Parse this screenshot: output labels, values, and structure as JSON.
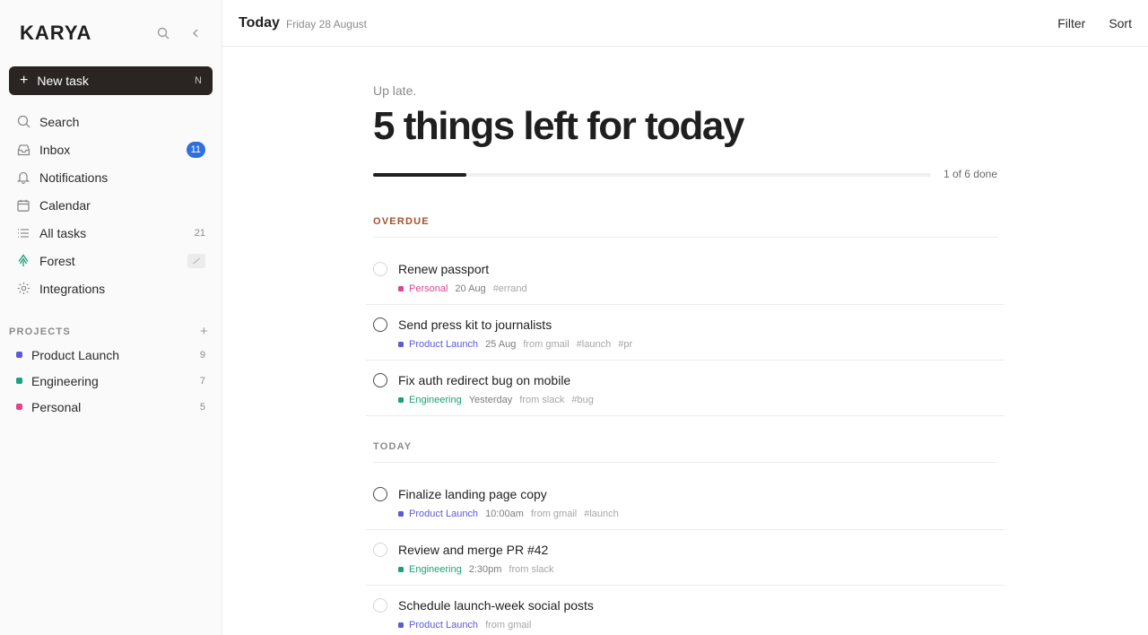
{
  "colors": {
    "accent_badge": "#2f6fdc",
    "product_launch": "#5b5bd6",
    "engineering": "#1aa27a",
    "personal": "#e0458e",
    "overdue": "#a0522d"
  },
  "sidebar": {
    "logo": "KARYA",
    "new_task": {
      "label": "New task",
      "shortcut": "N"
    },
    "nav": [
      {
        "label": "Search",
        "icon": "search-icon"
      },
      {
        "label": "Inbox",
        "icon": "inbox-icon",
        "badge": "11"
      },
      {
        "label": "Notifications",
        "icon": "bell-icon"
      },
      {
        "label": "Calendar",
        "icon": "calendar-icon"
      },
      {
        "label": "All tasks",
        "icon": "list-icon",
        "count": "21"
      },
      {
        "label": "Forest",
        "icon": "tree-icon"
      },
      {
        "label": "Integrations",
        "icon": "integrations-icon"
      }
    ],
    "projects_title": "PROJECTS",
    "projects": [
      {
        "label": "Product Launch",
        "count": "9"
      },
      {
        "label": "Engineering",
        "count": "7"
      },
      {
        "label": "Personal",
        "count": "5"
      }
    ]
  },
  "topbar": {
    "title": "Today",
    "date": "Friday 28 August",
    "filter": "Filter",
    "sort": "Sort"
  },
  "main": {
    "greeting": "Up late.",
    "headline": "5 things left for today",
    "progress": {
      "done": 1,
      "total": 6,
      "label": "1 of 6 done"
    }
  },
  "sections": [
    {
      "label": "OVERDUE",
      "tasks": [
        {
          "name": "Renew passport",
          "project": "Personal",
          "when": "20 Aug",
          "source": "",
          "tags": [
            "#errand"
          ]
        },
        {
          "name": "Send press kit to journalists",
          "project": "Product Launch",
          "when": "25 Aug",
          "source": "from gmail",
          "tags": [
            "#launch",
            "#pr"
          ]
        },
        {
          "name": "Fix auth redirect bug on mobile",
          "project": "Engineering",
          "when": "Yesterday",
          "source": "from slack",
          "tags": [
            "#bug"
          ]
        }
      ]
    },
    {
      "label": "TODAY",
      "tasks": [
        {
          "name": "Finalize landing page copy",
          "project": "Product Launch",
          "when": "10:00am",
          "source": "from gmail",
          "tags": [
            "#launch"
          ]
        },
        {
          "name": "Review and merge PR #42",
          "project": "Engineering",
          "when": "2:30pm",
          "source": "from slack",
          "tags": []
        },
        {
          "name": "Schedule launch-week social posts",
          "project": "Product Launch",
          "when": "",
          "source": "from gmail",
          "tags": []
        }
      ]
    }
  ]
}
